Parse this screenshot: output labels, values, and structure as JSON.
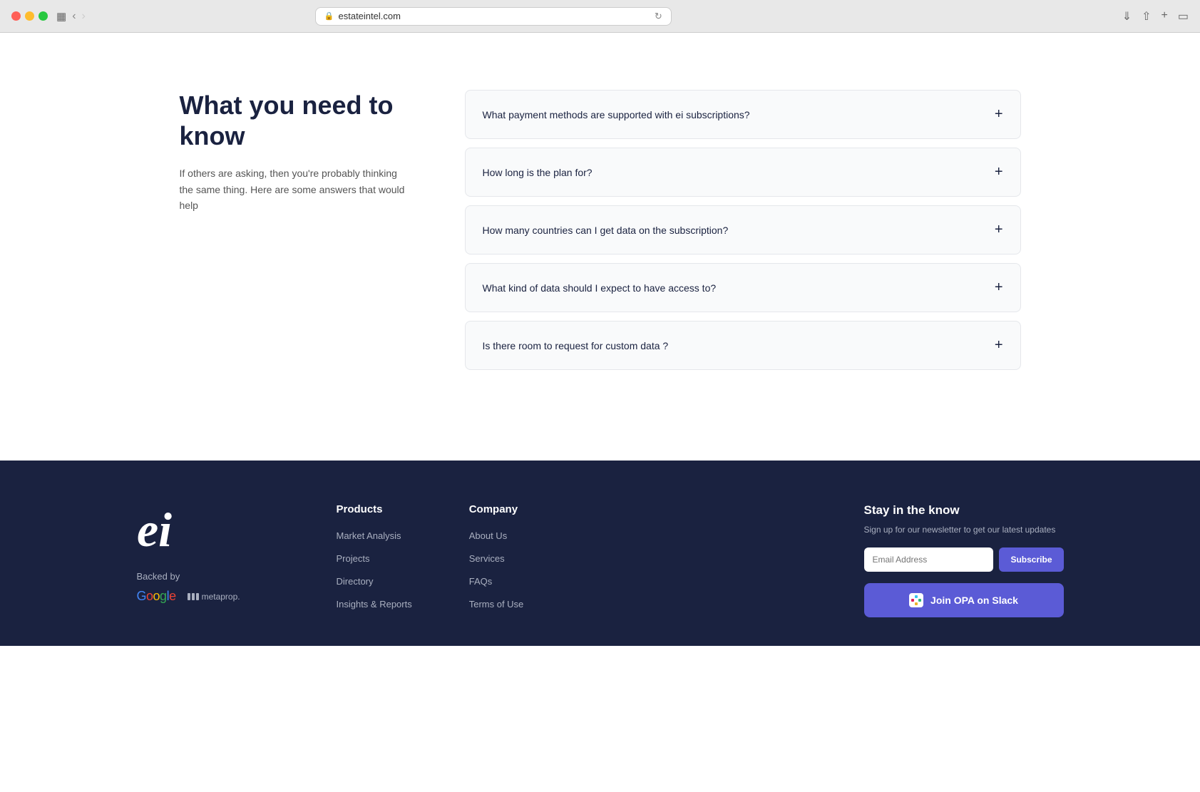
{
  "browser": {
    "url": "estateintel.com",
    "back_label": "‹",
    "forward_label": "›"
  },
  "faq": {
    "title": "What you need to know",
    "subtitle": "If others are asking, then you're probably thinking the same thing. Here are some answers that would help",
    "items": [
      {
        "id": 1,
        "question": "What payment methods are supported with ei subscriptions?"
      },
      {
        "id": 2,
        "question": "How long is the plan for?"
      },
      {
        "id": 3,
        "question": "How many countries can I get data on the subscription?"
      },
      {
        "id": 4,
        "question": "What kind of data should I expect to have access to?"
      },
      {
        "id": 5,
        "question": "Is there room to request for custom data ?"
      }
    ]
  },
  "footer": {
    "logo_text": "ei",
    "backed_by_label": "Backed by",
    "google_label": "Google",
    "metaprop_label": "metaprop.",
    "columns": [
      {
        "heading": "Products",
        "links": [
          {
            "label": "Market Analysis"
          },
          {
            "label": "Projects"
          },
          {
            "label": "Directory"
          },
          {
            "label": "Insights & Reports"
          }
        ]
      },
      {
        "heading": "Company",
        "links": [
          {
            "label": "About Us"
          },
          {
            "label": "Services"
          },
          {
            "label": "FAQs"
          },
          {
            "label": "Terms of Use"
          }
        ]
      }
    ],
    "newsletter": {
      "heading": "Stay in the know",
      "description": "Sign up for our newsletter to get our latest updates",
      "input_placeholder": "Email Address",
      "subscribe_label": "Subscribe",
      "join_opa_label": "Join OPA on  Slack"
    }
  }
}
